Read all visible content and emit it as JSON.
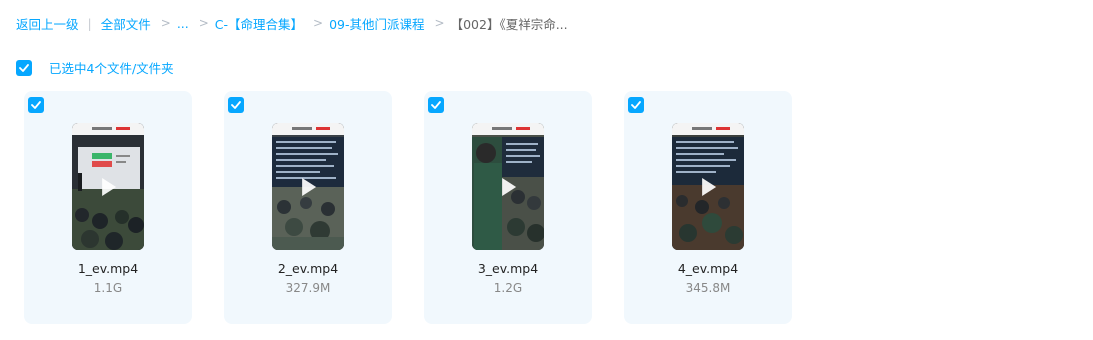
{
  "breadcrumb": {
    "back": "返回上一级",
    "pipe": "|",
    "sep": ">",
    "all_files": "全部文件",
    "ellipsis": "...",
    "folder1": "C-【命理合集】",
    "folder2": "09-其他门派课程",
    "current": "【002】《夏祥宗命..."
  },
  "selection": {
    "checked": true,
    "label": "已选中4个文件/文件夹"
  },
  "files": [
    {
      "name": "1_ev.mp4",
      "size": "1.1G",
      "checked": true
    },
    {
      "name": "2_ev.mp4",
      "size": "327.9M",
      "checked": true
    },
    {
      "name": "3_ev.mp4",
      "size": "1.2G",
      "checked": true
    },
    {
      "name": "4_ev.mp4",
      "size": "345.8M",
      "checked": true
    }
  ],
  "colors": {
    "accent": "#06a7ff",
    "card_bg": "#f1f8fd",
    "size_text": "#888888"
  },
  "icons": {
    "checkbox": "checkbox-checked-icon",
    "play": "play-icon"
  }
}
